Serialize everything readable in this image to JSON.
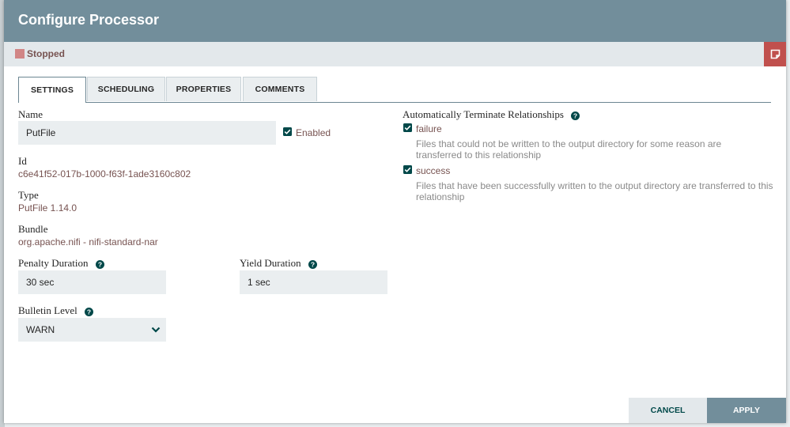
{
  "dialog": {
    "title": "Configure Processor"
  },
  "status": {
    "label": "Stopped"
  },
  "tabs": [
    {
      "label": "SETTINGS"
    },
    {
      "label": "SCHEDULING"
    },
    {
      "label": "PROPERTIES"
    },
    {
      "label": "COMMENTS"
    }
  ],
  "settings": {
    "name_label": "Name",
    "name_value": "PutFile",
    "enabled_label": "Enabled",
    "id_label": "Id",
    "id_value": "c6e41f52-017b-1000-f63f-1ade3160c802",
    "type_label": "Type",
    "type_value": "PutFile 1.14.0",
    "bundle_label": "Bundle",
    "bundle_value": "org.apache.nifi - nifi-standard-nar",
    "penalty_label": "Penalty Duration",
    "penalty_value": "30 sec",
    "yield_label": "Yield Duration",
    "yield_value": "1 sec",
    "bulletin_label": "Bulletin Level",
    "bulletin_value": "WARN"
  },
  "relationships": {
    "title": "Automatically Terminate Relationships",
    "items": [
      {
        "name": "failure",
        "description": "Files that could not be written to the output directory for some reason are transferred to this relationship"
      },
      {
        "name": "success",
        "description": "Files that have been successfully written to the output directory are transferred to this relationship"
      }
    ]
  },
  "footer": {
    "cancel_label": "CANCEL",
    "apply_label": "APPLY"
  },
  "colors": {
    "header": "#728e9b",
    "status_stopped": "#d18686",
    "notes_button": "#c0504d",
    "value_text": "#775351",
    "apply_button": "#728e9b",
    "checkbox": "#004849"
  },
  "icons": {
    "notes": "sticky-note-icon",
    "help": "question-circle-icon",
    "dropdown": "chevron-down-icon",
    "checkbox": "checkbox-checked-icon"
  }
}
